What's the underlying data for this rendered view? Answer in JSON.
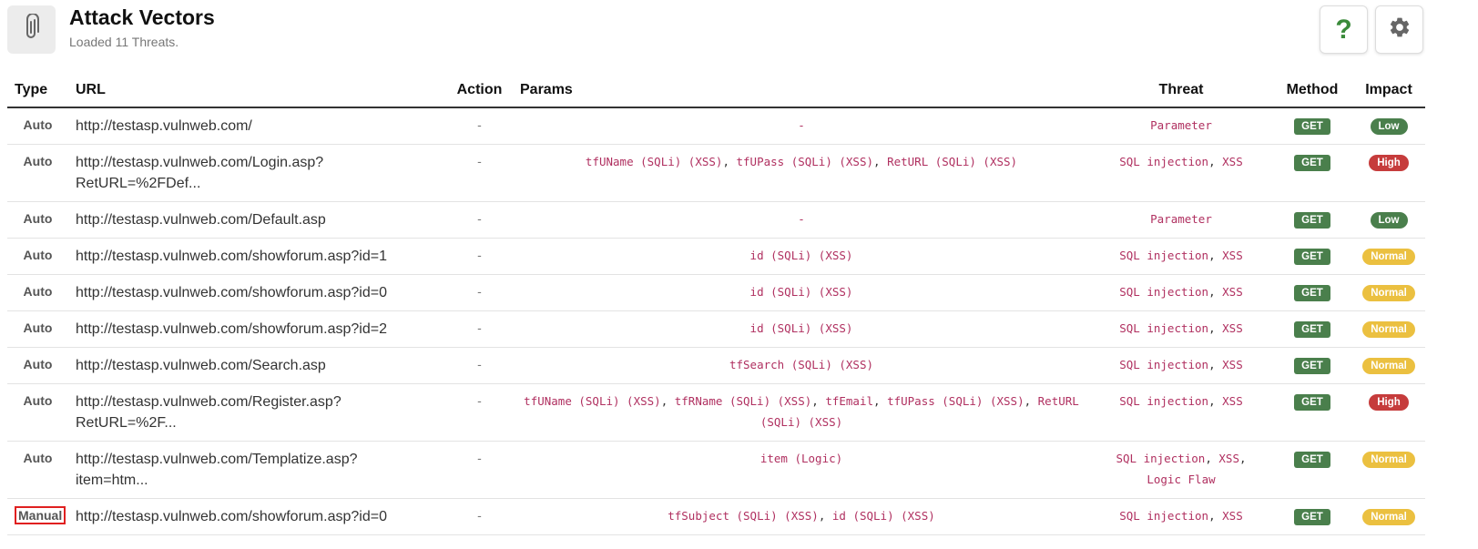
{
  "header": {
    "icon": "paperclip-icon",
    "title": "Attack Vectors",
    "subtitle": "Loaded 11 Threats.",
    "help_icon": "question-mark-icon",
    "settings_icon": "gear-icon"
  },
  "table": {
    "columns": [
      "Type",
      "URL",
      "Action",
      "Params",
      "Threat",
      "Method",
      "Impact"
    ],
    "rows": [
      {
        "type": "Auto",
        "url_lines": [
          "http://testasp.vulnweb.com/"
        ],
        "action": "-",
        "params": [
          "-"
        ],
        "threat": [
          "Parameter"
        ],
        "method": "GET",
        "impact": "Low"
      },
      {
        "type": "Auto",
        "url_lines": [
          "http://testasp.vulnweb.com/Login.asp?",
          "RetURL=%2FDef..."
        ],
        "action": "-",
        "params": [
          "tfUName (SQLi) (XSS)",
          "tfUPass (SQLi) (XSS)",
          "RetURL (SQLi) (XSS)"
        ],
        "threat": [
          "SQL injection",
          "XSS"
        ],
        "method": "GET",
        "impact": "High"
      },
      {
        "type": "Auto",
        "url_lines": [
          "http://testasp.vulnweb.com/Default.asp"
        ],
        "action": "-",
        "params": [
          "-"
        ],
        "threat": [
          "Parameter"
        ],
        "method": "GET",
        "impact": "Low"
      },
      {
        "type": "Auto",
        "url_lines": [
          "http://testasp.vulnweb.com/showforum.asp?id=1"
        ],
        "action": "-",
        "params": [
          "id (SQLi) (XSS)"
        ],
        "threat": [
          "SQL injection",
          "XSS"
        ],
        "method": "GET",
        "impact": "Normal"
      },
      {
        "type": "Auto",
        "url_lines": [
          "http://testasp.vulnweb.com/showforum.asp?id=0"
        ],
        "action": "-",
        "params": [
          "id (SQLi) (XSS)"
        ],
        "threat": [
          "SQL injection",
          "XSS"
        ],
        "method": "GET",
        "impact": "Normal"
      },
      {
        "type": "Auto",
        "url_lines": [
          "http://testasp.vulnweb.com/showforum.asp?id=2"
        ],
        "action": "-",
        "params": [
          "id (SQLi) (XSS)"
        ],
        "threat": [
          "SQL injection",
          "XSS"
        ],
        "method": "GET",
        "impact": "Normal"
      },
      {
        "type": "Auto",
        "url_lines": [
          "http://testasp.vulnweb.com/Search.asp"
        ],
        "action": "-",
        "params": [
          "tfSearch (SQLi) (XSS)"
        ],
        "threat": [
          "SQL injection",
          "XSS"
        ],
        "method": "GET",
        "impact": "Normal"
      },
      {
        "type": "Auto",
        "url_lines": [
          "http://testasp.vulnweb.com/Register.asp?",
          "RetURL=%2F..."
        ],
        "action": "-",
        "params": [
          "tfUName (SQLi) (XSS)",
          "tfRName (SQLi) (XSS)",
          "tfEmail",
          "tfUPass (SQLi) (XSS)",
          "RetURL (SQLi) (XSS)"
        ],
        "threat": [
          "SQL injection",
          "XSS"
        ],
        "method": "GET",
        "impact": "High"
      },
      {
        "type": "Auto",
        "url_lines": [
          "http://testasp.vulnweb.com/Templatize.asp?",
          "item=htm..."
        ],
        "action": "-",
        "params": [
          "item (Logic)"
        ],
        "threat": [
          "SQL injection",
          "XSS",
          "Logic Flaw"
        ],
        "method": "GET",
        "impact": "Normal"
      },
      {
        "type": "Manual",
        "url_lines": [
          "http://testasp.vulnweb.com/showforum.asp?id=0"
        ],
        "action": "-",
        "params": [
          "tfSubject (SQLi) (XSS)",
          "id (SQLi) (XSS)"
        ],
        "threat": [
          "SQL injection",
          "XSS"
        ],
        "method": "GET",
        "impact": "Normal"
      }
    ]
  },
  "colors": {
    "param_text": "#b03060",
    "get_badge": "#4a7f4c",
    "impact_low": "#4a7f4c",
    "impact_high": "#c63c3c",
    "impact_normal": "#ebc040",
    "manual_highlight": "#e02020",
    "help_icon": "#3a8a3a"
  }
}
